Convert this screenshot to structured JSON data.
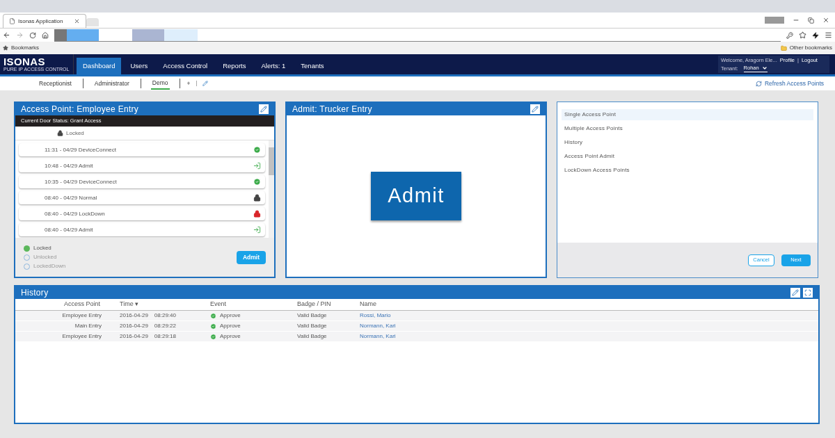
{
  "browser": {
    "tab_title": "Isonas Application",
    "bookmarks_label": "Bookmarks",
    "other_bookmarks": "Other bookmarks"
  },
  "nav": {
    "logo": "ISONAS",
    "logo_tagline": "PURE IP ACCESS CONTROL",
    "items": [
      {
        "label": "Dashboard",
        "selected": true
      },
      {
        "label": "Users",
        "selected": false
      },
      {
        "label": "Access Control",
        "selected": false
      },
      {
        "label": "Reports",
        "selected": false
      },
      {
        "label": "Alerts: 1",
        "selected": false
      },
      {
        "label": "Tenants",
        "selected": false
      }
    ],
    "welcome": "Welcome, Aragorn Ele...",
    "profile": "Profile",
    "separator": "|",
    "logout": "Logout",
    "tenant_label": "Tenant:",
    "tenant_value": "Rohan"
  },
  "subnav": {
    "tabs": [
      {
        "label": "Receptionist",
        "selected": false
      },
      {
        "label": "Administrator",
        "selected": false
      },
      {
        "label": "Demo",
        "selected": true
      }
    ],
    "add": "+",
    "refresh": "Refresh Access Points"
  },
  "access_point_panel": {
    "title": "Access Point: Employee Entry",
    "door_status": "Current Door Status:  Grant Access",
    "lock_state": "Locked",
    "events": [
      {
        "text": "11:31 - 04/29  DeviceConnect",
        "kind": "check"
      },
      {
        "text": "10:48 - 04/29  Admit",
        "kind": "admit"
      },
      {
        "text": "10:35 - 04/29  DeviceConnect",
        "kind": "check"
      },
      {
        "text": "08:40 - 04/29  Normal",
        "kind": "lock"
      },
      {
        "text": "08:40 - 04/29  LockDown",
        "kind": "lockdown"
      },
      {
        "text": "08:40 - 04/29  Admit",
        "kind": "admit"
      }
    ],
    "modes": [
      {
        "label": "Locked",
        "selected": true,
        "disabled": false
      },
      {
        "label": "Unlocked",
        "selected": false,
        "disabled": true
      },
      {
        "label": "LockedDown",
        "selected": false,
        "disabled": true
      }
    ],
    "admit_button": "Admit"
  },
  "admit_panel": {
    "title": "Admit: Trucker Entry",
    "button": "Admit"
  },
  "wizard_panel": {
    "options": [
      {
        "label": "Single Access Point",
        "selected": true
      },
      {
        "label": "Multiple Access Points",
        "selected": false
      },
      {
        "label": "History",
        "selected": false
      },
      {
        "label": "Access Point Admit",
        "selected": false
      },
      {
        "label": "LockDown Access Points",
        "selected": false
      }
    ],
    "cancel": "Cancel",
    "next": "Next"
  },
  "history": {
    "title": "History",
    "columns": [
      "Access Point",
      "Time ▾",
      "Event",
      "Badge / PIN",
      "Name"
    ],
    "rows": [
      {
        "access_point": "Employee Entry",
        "date": "2016-04-29",
        "time": "08:29:40",
        "event": "Approve",
        "badge": "Valid Badge",
        "name": "Rossi, Mario"
      },
      {
        "access_point": "Main Entry",
        "date": "2016-04-29",
        "time": "08:29:22",
        "event": "Approve",
        "badge": "Valid Badge",
        "name": "Normann, Kari"
      },
      {
        "access_point": "Employee Entry",
        "date": "2016-04-29",
        "time": "08:29:18",
        "event": "Approve",
        "badge": "Valid Badge",
        "name": "Normann, Kari"
      }
    ]
  }
}
